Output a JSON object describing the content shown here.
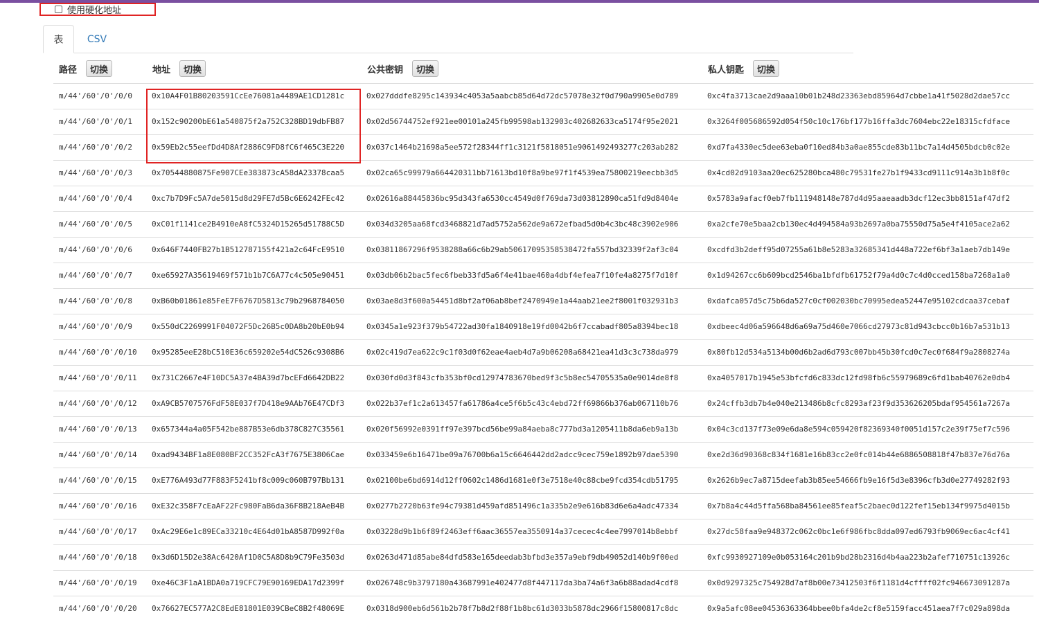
{
  "options": {
    "use_hardened_label": "使用硬化地址",
    "use_hardened_checked": false
  },
  "tabs": [
    {
      "label": "表",
      "active": true
    },
    {
      "label": "CSV",
      "active": false
    }
  ],
  "table": {
    "headers": {
      "path": "路径",
      "address": "地址",
      "public_key": "公共密钥",
      "private_key": "私人钥匙"
    },
    "toggle_label": "切换",
    "rows": [
      {
        "path": "m/44'/60'/0'/0/0",
        "address": "0x10A4F01B80203591CcEe76081a4489AE1CD1281c",
        "public_key": "0x027dddfe8295c143934c4053a5aabcb85d64d72dc57078e32f0d790a9905e0d789",
        "private_key": "0xc4fa3713cae2d9aaa10b01b248d23363ebd85964d7cbbe1a41f5028d2dae57cc"
      },
      {
        "path": "m/44'/60'/0'/0/1",
        "address": "0x152c90200bE61a540875f2a752C328BD19dbFB87",
        "public_key": "0x02d56744752ef921ee00101a245fb99598ab132903c402682633ca5174f95e2021",
        "private_key": "0x3264f005686592d054f50c10c176bf177b16ffa3dc7604ebc22e18315cfdface"
      },
      {
        "path": "m/44'/60'/0'/0/2",
        "address": "0x59Eb2c55eefDd4D8Af2886C9FD8fC6f465C3E220",
        "public_key": "0x037c1464b21698a5ee572f28344ff1c3121f5818051e9061492493277c203ab282",
        "private_key": "0xd7fa4330ec5dee63eba0f10ed84b3a0ae855cde83b11bc7a14d4505bdcb0c02e"
      },
      {
        "path": "m/44'/60'/0'/0/3",
        "address": "0x70544880875Fe907CEe383873cA58dA23378caa5",
        "public_key": "0x02ca65c99979a664420311bb71613bd10f8a9be97f1f4539ea75800219eecbb3d5",
        "private_key": "0x4cd02d9103aa20ec625280bca480c79531fe27b1f9433cd9111c914a3b1b8f0c"
      },
      {
        "path": "m/44'/60'/0'/0/4",
        "address": "0xc7b7D9Fc5A7de5015d8d29FE7d5Bc6E6242FEc42",
        "public_key": "0x02616a88445836bc95d343fa6530cc4549d0f769da73d03812890ca51fd9d8404e",
        "private_key": "0x5783a9afacf0eb7fb111948148e787d4d95aaeaadb3dcf12ec3bb8151af47df2"
      },
      {
        "path": "m/44'/60'/0'/0/5",
        "address": "0xC01f1141ce2B4910eA8fC5324D15265d51788C5D",
        "public_key": "0x034d3205aa68fcd3468821d7ad5752a562de9a672efbad5d0b4c3bc48c3902e906",
        "private_key": "0xa2cfe70e5baa2cb130ec4d494584a93b2697a0ba75550d75a5e4f4105ace2a62"
      },
      {
        "path": "m/44'/60'/0'/0/6",
        "address": "0x646F7440FB27b1B512787155f421a2c64FcE9510",
        "public_key": "0x03811867296f9538288a66c6b29ab50617095358538472fa557bd32339f2af3c04",
        "private_key": "0xcdfd3b2deff95d07255a61b8e5283a32685341d448a722ef6bf3a1aeb7db149e"
      },
      {
        "path": "m/44'/60'/0'/0/7",
        "address": "0xe65927A35619469f571b1b7C6A77c4c505e90451",
        "public_key": "0x03db06b2bac5fec6fbeb33fd5a6f4e41bae460a4dbf4efea7f10fe4a8275f7d10f",
        "private_key": "0x1d94267cc6b609bcd2546ba1bfdfb61752f79a4d0c7c4d0cced158ba7268a1a0"
      },
      {
        "path": "m/44'/60'/0'/0/8",
        "address": "0xB60b01861e85FeE7F6767D5813c79b2968784050",
        "public_key": "0x03ae8d3f600a54451d8bf2af06ab8bef2470949e1a44aab21ee2f8001f032931b3",
        "private_key": "0xdafca057d5c75b6da527c0cf002030bc70995edea52447e95102cdcaa37cebaf"
      },
      {
        "path": "m/44'/60'/0'/0/9",
        "address": "0x550dC2269991F04072F5Dc26B5c0DA8b20bE0b94",
        "public_key": "0x0345a1e923f379b54722ad30fa1840918e19fd0042b6f7ccabadf805a8394bec18",
        "private_key": "0xdbeec4d06a596648d6a69a75d460e7066cd27973c81d943cbcc0b16b7a531b13"
      },
      {
        "path": "m/44'/60'/0'/0/10",
        "address": "0x95285eeE28bC510E36c659202e54dC526c9308B6",
        "public_key": "0x02c419d7ea622c9c1f03d0f62eae4aeb4d7a9b06208a68421ea41d3c3c738da979",
        "private_key": "0x80fb12d534a5134b00d6b2ad6d793c007bb45b30fcd0c7ec0f684f9a2808274a"
      },
      {
        "path": "m/44'/60'/0'/0/11",
        "address": "0x731C2667e4F10DC5A37e4BA39d7bcEFd6642DB22",
        "public_key": "0x030fd0d3f843cfb353bf0cd12974783670bed9f3c5b8ec54705535a0e9014de8f8",
        "private_key": "0xa4057017b1945e53bfcfd6c833dc12fd98fb6c55979689c6fd1bab40762e0db4"
      },
      {
        "path": "m/44'/60'/0'/0/12",
        "address": "0xA9CB5707576FdF58E037f7D418e9AAb76E47CDf3",
        "public_key": "0x022b37ef1c2a613457fa61786a4ce5f6b5c43c4ebd72ff69866b376ab067110b76",
        "private_key": "0x24cffb3db7b4e040e213486b8cfc8293af23f9d353626205bdaf954561a7267a"
      },
      {
        "path": "m/44'/60'/0'/0/13",
        "address": "0x657344a4a05F542be887B53e6db378C827C35561",
        "public_key": "0x020f56992e0391ff97e397bcd56be99a84aeba8c777bd3a1205411b8da6eb9a13b",
        "private_key": "0x04c3cd137f73e09e6da8e594c059420f82369340f0051d157c2e39f75ef7c596"
      },
      {
        "path": "m/44'/60'/0'/0/14",
        "address": "0xad9434BF1a8E080BF2CC352FcA3f7675E3806Cae",
        "public_key": "0x033459e6b16471be09a76700b6a15c6646442dd2adcc9cec759e1892b97dae5390",
        "private_key": "0xe2d36d90368c834f1681e16b83cc2e0fc014b44e6886508818f47b837e76d76a"
      },
      {
        "path": "m/44'/60'/0'/0/15",
        "address": "0xE776A493d77F883F5241bf8c009c060B797Bb131",
        "public_key": "0x02100be6bd6914d12ff0602c1486d1681e0f3e7518e40c88cbe9fcd354cdb51795",
        "private_key": "0x2626b9ec7a8715deefab3b85ee54666fb9e16f5d3e8396cfb3d0e27749282f93"
      },
      {
        "path": "m/44'/60'/0'/0/16",
        "address": "0xE32c358F7cEaAF22Fc980FaB6da36F8B218AeB4B",
        "public_key": "0x0277b2720b63fe94c79381d459afd851496c1a335b2e9e616b83d6e6a4adc47334",
        "private_key": "0x7b8a4c44d5ffa568ba84561ee85feaf5c2baec0d122fef15eb134f9975d4015b"
      },
      {
        "path": "m/44'/60'/0'/0/17",
        "address": "0xAc29E6e1c89ECa33210c4E64d01bA8587D992f0a",
        "public_key": "0x03228d9b1b6f89f2463eff6aac36557ea3550914a37cecec4c4ee7997014b8ebbf",
        "private_key": "0x27dc58faa9e948372c062c0bc1e6f986fbc8dda097ed6793fb9069ec6ac4cf41"
      },
      {
        "path": "m/44'/60'/0'/0/18",
        "address": "0x3d6D15D2e38Ac6420Af1D0C5A8D8b9C79Fe3503d",
        "public_key": "0x0263d471d85abe84dfd583e165deedab3bfbd3e357a9ebf9db49052d140b9f00ed",
        "private_key": "0xfc9930927109e0b053164c201b9bd28b2316d4b4aa223b2afef710751c13926c"
      },
      {
        "path": "m/44'/60'/0'/0/19",
        "address": "0xe46C3F1aA1BDA0a719CFC79E90169EDA17d2399f",
        "public_key": "0x026748c9b3797180a43687991e402477d8f447117da3ba74a6f3a6b88adad4cdf8",
        "private_key": "0x0d9297325c754928d7af8b00e73412503f6f1181d4cffff02fc946673091287a"
      },
      {
        "path": "m/44'/60'/0'/0/20",
        "address": "0x76627EC577A2C8EdE81801E039CBeC8B2f48069E",
        "public_key": "0x0318d900eb6d561b2b78f7b8d2f88f1b8bc61d3033b5878dc2966f15800817c8dc",
        "private_key": "0x9a5afc08ee04536363364bbee0bfa4de2cf8e5159facc451aea7f7c029a898da"
      }
    ]
  }
}
